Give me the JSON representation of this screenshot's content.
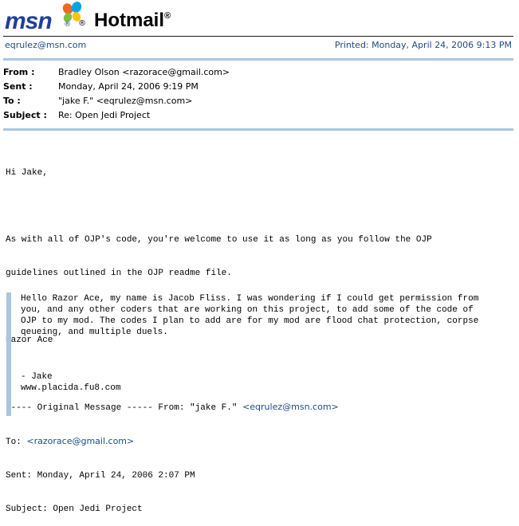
{
  "header": {
    "brand": "msn",
    "brand_reg": "®",
    "butterfly_reg": "®",
    "product": "Hotmail",
    "product_reg": "®",
    "account_email": "eqrulez@msn.com",
    "printed": "Printed: Monday, April 24, 2006 9:13 PM"
  },
  "fields": [
    {
      "label": "From :",
      "value": "Bradley Olson <razorace@gmail.com>"
    },
    {
      "label": "Sent :",
      "value": "Monday, April 24, 2006 9:19 PM"
    },
    {
      "label": "To :",
      "value": "\"jake F.\" <eqrulez@msn.com>"
    },
    {
      "label": "Subject :",
      "value": "Re: Open Jedi Project"
    }
  ],
  "message": {
    "greeting": "Hi Jake,",
    "line1": "As with all of OJP's code, you're welcome to use it as long as you follow the OJP",
    "line2": "guidelines outlined in the OJP readme file.",
    "signature": "Razor Ace",
    "orig_prefix": "----- Original Message ----- From: \"jake F.\" ",
    "orig_from_email": "<eqrulez@msn.com>",
    "orig_to_prefix": "To: ",
    "orig_to_email": "<razorace@gmail.com>",
    "orig_sent": "Sent: Monday, April 24, 2006 2:07 PM",
    "orig_subject": "Subject: Open Jedi Project"
  },
  "quote": {
    "line1": "Hello Razor Ace, my name is Jacob Fliss. I was wondering if I could get permission from",
    "line2": "you, and any other coders that are working on this project, to add some of the code of",
    "line3": "OJP to my mod. The codes I plan to add are for my mod are flood chat protection, corpse",
    "line4": "qeueing, and multiple duels.",
    "sig_name": "- Jake",
    "sig_url": "www.placida.fu8.com"
  },
  "colors": {
    "accent": "#1e4a8a",
    "rule_blue": "#a9c6e0"
  }
}
